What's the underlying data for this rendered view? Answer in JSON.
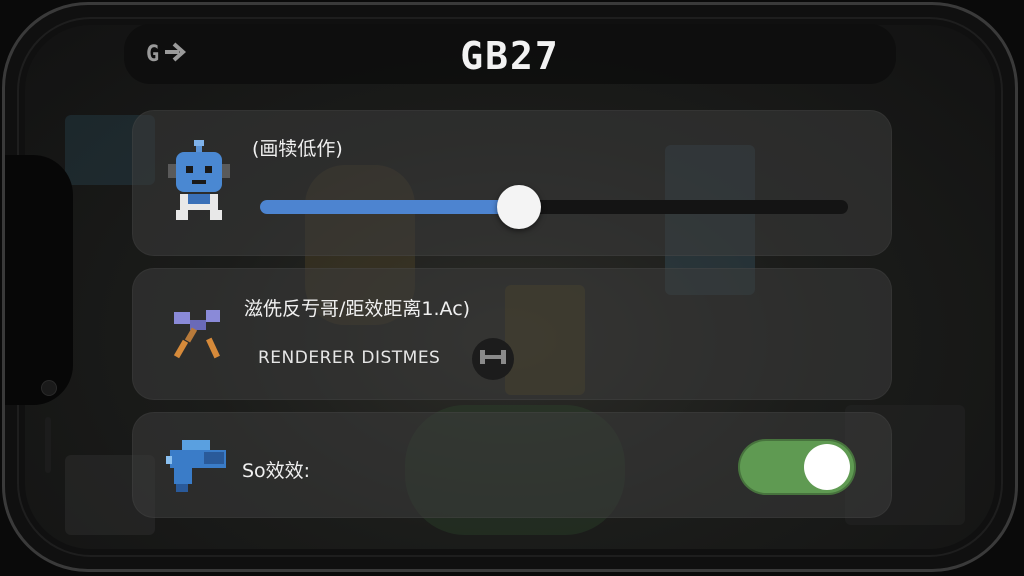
{
  "header": {
    "back_label": "G",
    "title": "GB27"
  },
  "settings": [
    {
      "label": "(画犊低作)",
      "icon": "robot-face-icon",
      "control": "slider",
      "slider_value": 0.44
    },
    {
      "label": "滋侁反亐哥/距效距离1.Ac)",
      "icon": "crossed-tools-icon",
      "sub_label": "RENDERER DISTMES",
      "sub_icon": "dumbbell-icon"
    },
    {
      "label": "So效效:",
      "icon": "blaster-icon",
      "control": "toggle",
      "toggle_on": true
    }
  ],
  "colors": {
    "slider_fill": "#4d84d0",
    "toggle_on": "#5f9a52"
  }
}
